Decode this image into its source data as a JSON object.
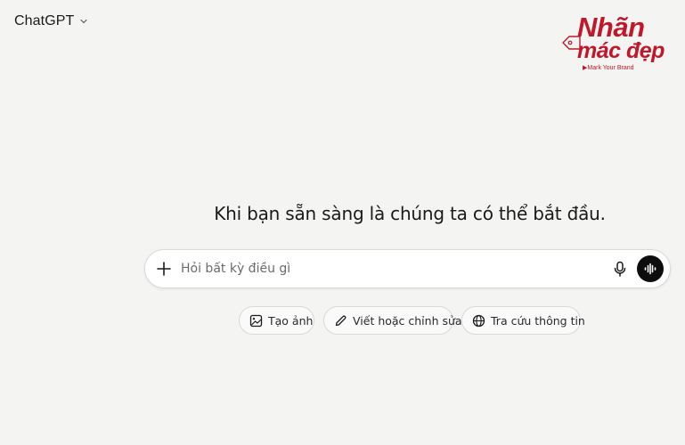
{
  "header": {
    "model_name": "ChatGPT",
    "model_chevron_icon": "chevron-down-icon"
  },
  "watermark": {
    "line1": "Nhãn",
    "line2": "mác đẹp",
    "slogan": "▶Mark Your Brand",
    "color": "#c0182a"
  },
  "main": {
    "headline": "Khi bạn sẵn sàng là chúng ta có thể bắt đầu."
  },
  "composer": {
    "placeholder": "Hỏi bất kỳ điều gì",
    "value": "",
    "plus_icon": "plus-icon",
    "mic_icon": "mic-icon",
    "voice_icon": "voice-mode-icon"
  },
  "suggestions": [
    {
      "label": "Tạo ảnh",
      "icon": "image-icon"
    },
    {
      "label": "Viết hoặc chỉnh sửa",
      "icon": "pencil-icon"
    },
    {
      "label": "Tra cứu thông tin",
      "icon": "globe-icon"
    }
  ],
  "colors": {
    "background": "#f4f4f3",
    "composer_bg": "#ffffff",
    "voice_button": "#0d0d0d"
  }
}
